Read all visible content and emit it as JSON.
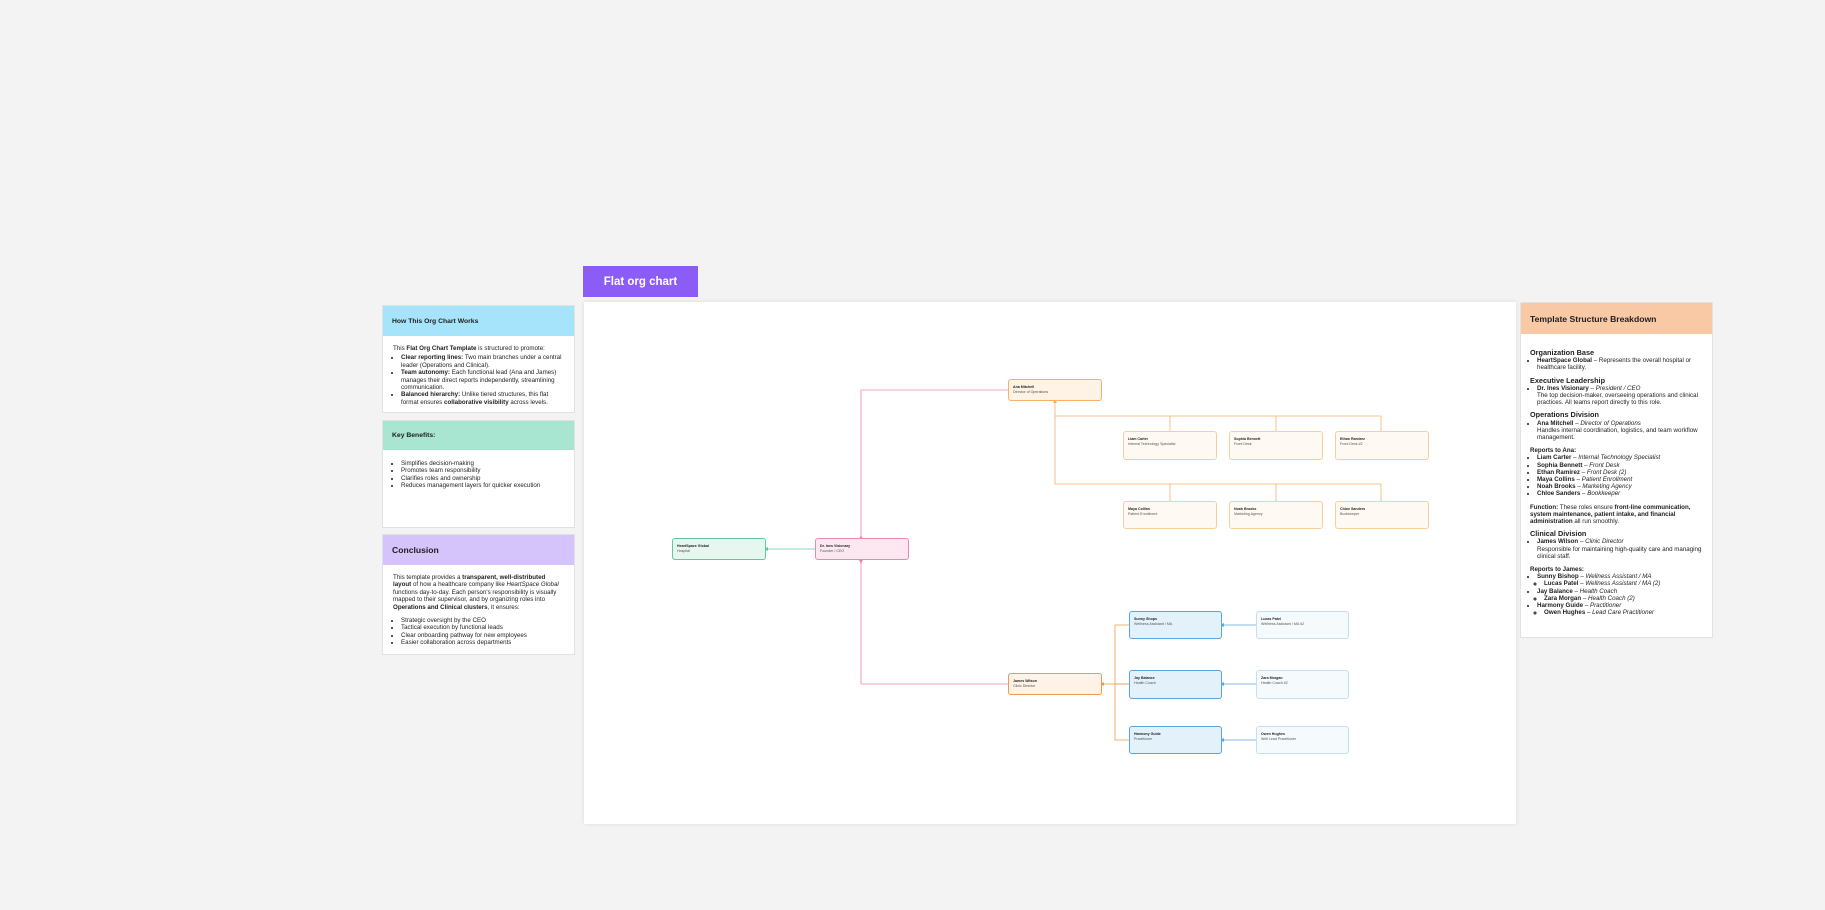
{
  "title_tab": "Flat org chart",
  "left": {
    "how": {
      "title": "How This Org Chart Works",
      "intro_pre": "This ",
      "intro_b": "Flat Org Chart Template",
      "intro_post": " is structured to promote:",
      "items": [
        {
          "b": "Clear reporting lines:",
          "t": " Two main branches under a central leader (Operations and Clinical)."
        },
        {
          "b": "Team autonomy:",
          "t": " Each functional lead (Ana and James) manages their direct reports independently, streamlining communication."
        },
        {
          "b": "Balanced hierarchy:",
          "t": " Unlike tiered structures, this flat format ensures ",
          "b2": "collaborative visibility",
          "t2": " across levels."
        }
      ]
    },
    "benefits": {
      "title": "Key Benefits:",
      "items": [
        "Simplifies decision-making",
        "Promotes team responsibility",
        "Clarifies roles and ownership",
        "Reduces management layers for quicker execution"
      ]
    },
    "conclusion": {
      "title": "Conclusion",
      "p1": "This template provides a ",
      "p1b": "transparent, well-distributed layout",
      "p2": " of how a healthcare company like ",
      "p2i": "HeartSpace Global",
      "p3": " functions day-to-day. Each person's responsibility is visually mapped to their supervisor, and by organizing roles into ",
      "p3b": "Operations and Clinical clusters",
      "p4": ", it ensures:",
      "items": [
        "Strategic oversight by the CEO",
        "Tactical execution by functional leads",
        "Clear onboarding pathway for new employees",
        "Easier collaboration across departments"
      ]
    }
  },
  "nodes": {
    "hsg": {
      "name": "HeartSpace Global",
      "role": "Hospital"
    },
    "ines": {
      "name": "Dr. Ines Visionary",
      "role": "Founder / CEO"
    },
    "ana": {
      "name": "Ana Mitchell",
      "role": "Director of Operations"
    },
    "liam": {
      "name": "Liam Carter",
      "role": "Internal Technology Specialist"
    },
    "sophia": {
      "name": "Sophia Bennett",
      "role": "Front Desk"
    },
    "ethan": {
      "name": "Ethan Ramirez",
      "role": "Front Desk #2"
    },
    "maya": {
      "name": "Maya Collins",
      "role": "Patient Enrollment"
    },
    "noah": {
      "name": "Noah Brooks",
      "role": "Marketing Agency"
    },
    "chloe": {
      "name": "Chloe Sanders",
      "role": "Bookkeeper"
    },
    "james": {
      "name": "James Wilson",
      "role": "Clinic Director"
    },
    "sunny": {
      "name": "Sunny Shops",
      "role": "Wellness Assistant / MA"
    },
    "lucas": {
      "name": "Lucas Patel",
      "role": "Wellness Assistant / MA #2"
    },
    "jay": {
      "name": "Jay Balance",
      "role": "Health Coach"
    },
    "zara": {
      "name": "Zara Morgan",
      "role": "Health Coach #2"
    },
    "harmony": {
      "name": "Harmony Guide",
      "role": "Practitioner"
    },
    "owen": {
      "name": "Owen Hughes",
      "role": "Well Lead Practitioner"
    }
  },
  "right": {
    "title": "Template Structure Breakdown",
    "org_base_h": "Organization Base",
    "org_base_b": "HeartSpace Global",
    "org_base_t": " – Represents the overall hospital or healthcare facility.",
    "exec_h": "Executive Leadership",
    "exec_b": "Dr. Ines Visionary",
    "exec_i": "President / CEO",
    "exec_t": "The top decision-maker, overseeing operations and clinical practices. All teams report directly to this role.",
    "ops_h": "Operations Division",
    "ops_b": "Ana Mitchell",
    "ops_i": "Director of Operations",
    "ops_t": "Handles internal coordination, logistics, and team workflow management.",
    "ana_h": "Reports to Ana:",
    "ana_reports": [
      {
        "b": "Liam Carter",
        "i": "Internal Technology Specialist"
      },
      {
        "b": "Sophia Bennett",
        "i": "Front Desk"
      },
      {
        "b": "Ethan Ramirez",
        "i": "Front Desk (2)"
      },
      {
        "b": "Maya Collins",
        "i": "Patient Enrollment"
      },
      {
        "b": "Noah Brooks",
        "i": "Marketing Agency"
      },
      {
        "b": "Chloe Sanders",
        "i": "Bookkeeper"
      }
    ],
    "func_b": "Function:",
    "func_t1": " These roles ensure ",
    "func_bb": "front-line communication, system maintenance, patient intake, and financial administration",
    "func_t2": " all run smoothly.",
    "clin_h": "Clinical Division",
    "clin_b": "James Wilson",
    "clin_i": "Clinic Director",
    "clin_t": "Responsible for maintaining high-quality care and managing clinical staff.",
    "james_h": "Reports to James:",
    "sunny_b": "Sunny Bishop",
    "sunny_i": "Wellness Assistant / MA",
    "lucas_b": "Lucas Patel",
    "lucas_i": "Wellness Assistant / MA (2)",
    "jay_b": "Jay Balance",
    "jay_i": "Health Coach",
    "zara_b": "Zara Morgan",
    "zara_i": "Health Coach (2)",
    "harm_b": "Harmony Guide",
    "harm_i": "Practitioner",
    "owen_b": "Owen Hughes",
    "owen_i": "Lead Care Practitioner"
  },
  "colors": {
    "accent": "#8b5cf6",
    "how_header": "#a5e4fb",
    "benefits_header": "#a8e6d2",
    "conclusion_header": "#d5c4fb",
    "breakdown_header": "#f9c9a6"
  }
}
